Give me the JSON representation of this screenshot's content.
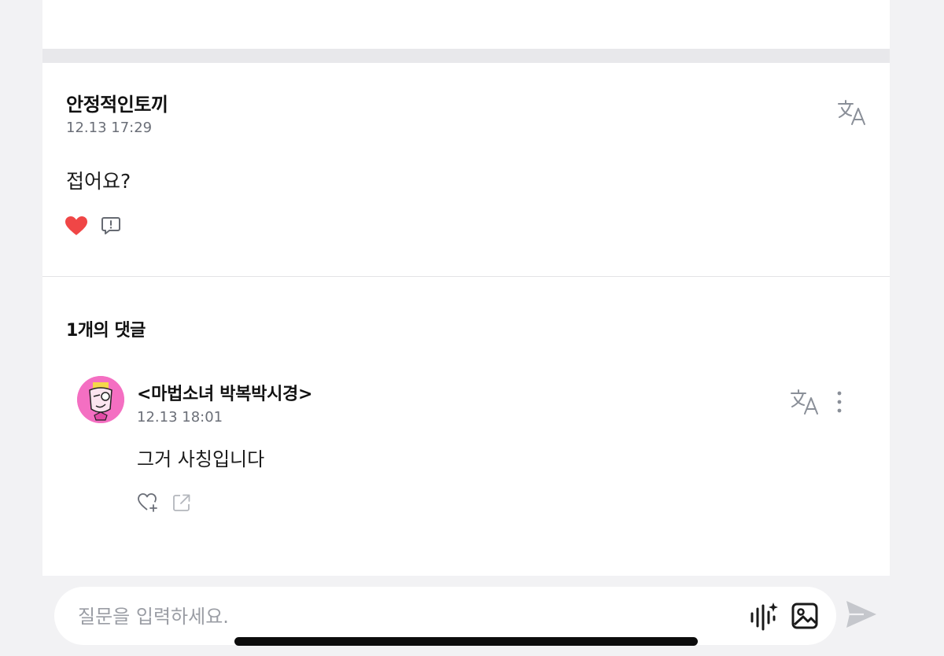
{
  "post": {
    "author": "안정적인토끼",
    "time": "12.13 17:29",
    "body": "접어요?",
    "liked": true,
    "icons": {
      "translate": "translate-icon",
      "like": "heart-filled-icon",
      "report": "report-icon"
    }
  },
  "comments": {
    "title": "1개의 댓글",
    "items": [
      {
        "author": "<마법소녀 박복박시경>",
        "time": "12.13 18:01",
        "body": "그거 사칭입니다",
        "icons": {
          "avatar": "pink-character-avatar",
          "translate": "translate-icon",
          "more": "more-vertical-icon",
          "like": "heart-plus-icon",
          "share": "share-icon"
        }
      }
    ]
  },
  "input": {
    "placeholder": "질문을 입력하세요.",
    "value": "",
    "icons": {
      "voice": "voice-ai-icon",
      "image": "image-icon",
      "send": "send-icon"
    }
  },
  "colors": {
    "heart": "#f04646",
    "band": "#e8e8eb",
    "background": "#f2f2f4",
    "muted_text": "#6b6f78"
  }
}
